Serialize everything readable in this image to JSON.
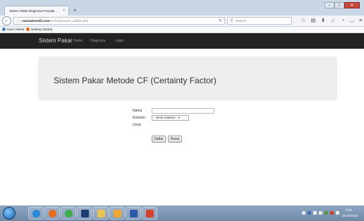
{
  "browser": {
    "tab_title": "Sistem Pakar Diagnosa Penyaki...",
    "tab_close": "×",
    "new_tab": "+",
    "url_host": "mariaahmedii.com",
    "url_path": "/CFfulk/posses_add/lm.php",
    "search_placeholder": "Search",
    "bookmarks": [
      "Most Visited",
      "Getting Started"
    ]
  },
  "site": {
    "brand": "Sistem Pakar",
    "nav": [
      "Home",
      "Diagnosa",
      "Login"
    ],
    "heading": "Sistem Pakar Metode CF (Certainty Factor)"
  },
  "form": {
    "nama_label": "Nama",
    "kelamin_label": "Kelamin",
    "kelamin_selected": "- Jenis Kelamin -",
    "umur_label": "Umur",
    "daftar_button": "Daftar",
    "reset_button": "Reset"
  },
  "taskbar": {
    "time": "8:04",
    "date": "21/07/2016"
  },
  "icons": [
    "arrow-left-icon",
    "info-icon",
    "reload-icon",
    "search-icon",
    "star-icon",
    "clipboard-icon",
    "download-icon",
    "home-icon",
    "history-icon",
    "pocket-icon",
    "menu-icon"
  ]
}
